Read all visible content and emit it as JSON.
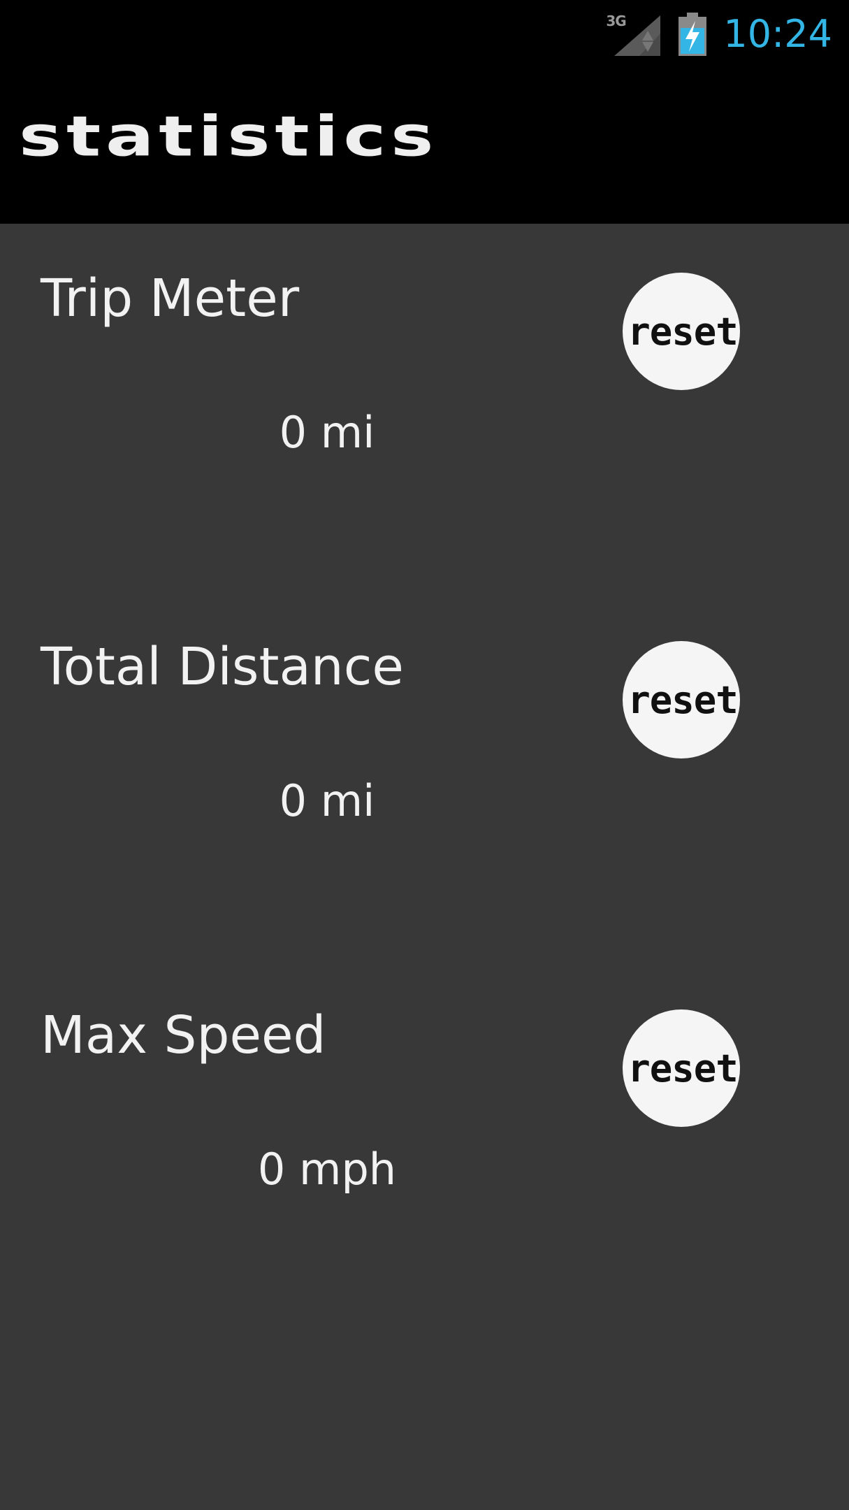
{
  "status_bar": {
    "network_type": "3G",
    "time": "10:24",
    "icons": [
      "signal-icon",
      "battery-charging-icon"
    ],
    "time_color": "#33b5e5"
  },
  "app": {
    "title": "statistics"
  },
  "stats": [
    {
      "label": "Trip Meter",
      "value": "0 mi",
      "reset_label": "reset"
    },
    {
      "label": "Total Distance",
      "value": "0 mi",
      "reset_label": "reset"
    },
    {
      "label": "Max Speed",
      "value": "0 mph",
      "reset_label": "reset"
    }
  ],
  "colors": {
    "background": "#383838",
    "header": "#000000",
    "text": "#f2f2f2",
    "button": "#f5f5f5"
  }
}
